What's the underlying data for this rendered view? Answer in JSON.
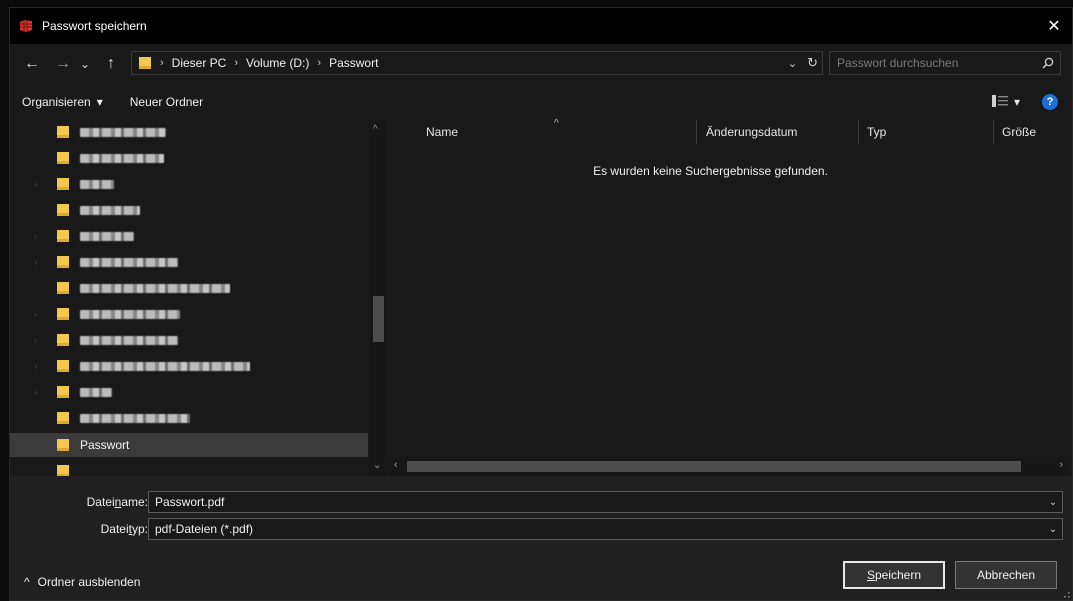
{
  "window": {
    "title": "Passwort speichern",
    "close_glyph": "✕"
  },
  "nav": {
    "back": "←",
    "forward": "→",
    "recent": "⌄",
    "up": "↑",
    "breadcrumbs": [
      {
        "label": "Dieser PC"
      },
      {
        "label": "Volume (D:)"
      },
      {
        "label": "Passwort"
      }
    ],
    "crumb_sep": "›",
    "dropdown_glyph": "⌄",
    "refresh_glyph": "↻",
    "search_placeholder": "Passwort durchsuchen"
  },
  "toolbar": {
    "organize_label": "Organisieren",
    "organize_caret": "▾",
    "new_folder_label": "Neuer Ordner",
    "view_caret": "▾",
    "help_glyph": "?"
  },
  "tree": {
    "selected_label": "Passwort",
    "items": [
      {
        "blur_width": 86,
        "has_expander": false
      },
      {
        "blur_width": 84,
        "has_expander": false
      },
      {
        "blur_width": 34,
        "has_expander": true
      },
      {
        "blur_width": 60,
        "has_expander": false
      },
      {
        "blur_width": 54,
        "has_expander": true
      },
      {
        "blur_width": 98,
        "has_expander": true
      },
      {
        "blur_width": 150,
        "has_expander": false
      },
      {
        "blur_width": 100,
        "has_expander": true
      },
      {
        "blur_width": 98,
        "has_expander": true
      },
      {
        "blur_width": 170,
        "has_expander": true
      },
      {
        "blur_width": 32,
        "has_expander": true
      },
      {
        "blur_width": 110,
        "has_expander": false
      }
    ]
  },
  "content": {
    "columns": [
      "Name",
      "Änderungsdatum",
      "Typ",
      "Größe"
    ],
    "empty_message": "Es wurden keine Suchergebnisse gefunden."
  },
  "form": {
    "filename_label_pre": "Datei",
    "filename_label_u": "n",
    "filename_label_post": "ame:",
    "filename_value": "Passwort.pdf",
    "filetype_label_pre": "Datei",
    "filetype_label_u": "t",
    "filetype_label_post": "yp:",
    "filetype_value": "pdf-Dateien (*.pdf)",
    "caret": "⌄"
  },
  "footer": {
    "hide_folders_label": "Ordner ausblenden",
    "hide_caret": "^",
    "save_u": "S",
    "save_rest": "peichern",
    "cancel_label": "Abbrechen"
  },
  "colors": {
    "accent_help": "#1e6fd9",
    "folder": "#f2c94c",
    "app_icon": "#d9312b"
  }
}
